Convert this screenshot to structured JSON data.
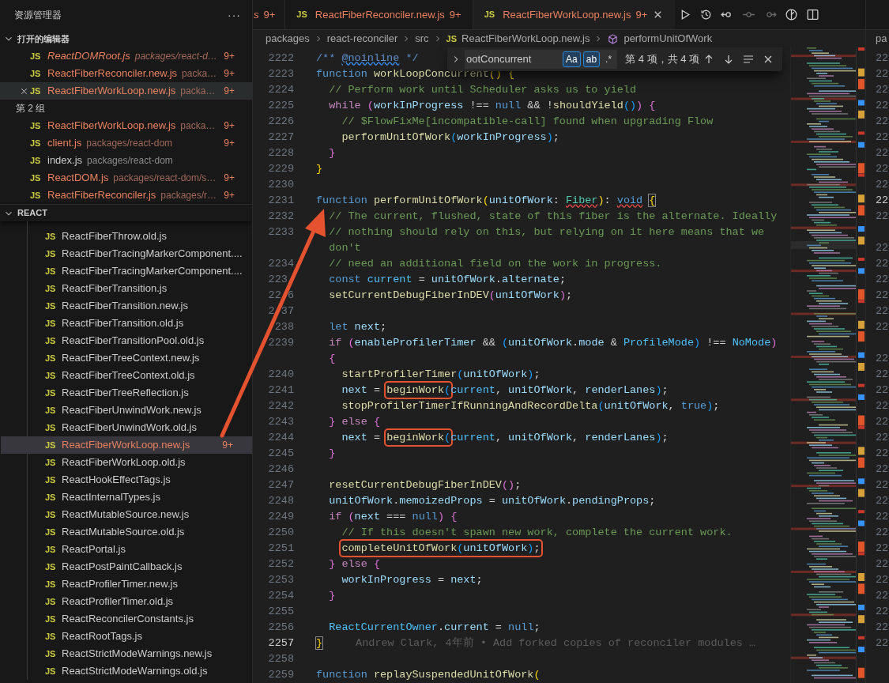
{
  "sidebar": {
    "title": "资源管理器",
    "more": "···",
    "open_editors": {
      "label": "打开的编辑器",
      "expanded": true,
      "groups": [
        {
          "items": [
            {
              "icon": "JS",
              "name": "ReactDOMRoot.js",
              "path": "packages/react-d…",
              "badge": "9+",
              "modified": true,
              "preview": true,
              "selected": false
            },
            {
              "icon": "JS",
              "name": "ReactFiberReconciler.new.js",
              "path": "packa…",
              "badge": "9+",
              "modified": true,
              "preview": false,
              "selected": false
            },
            {
              "icon": "JS",
              "name": "ReactFiberWorkLoop.new.js",
              "path": "packa…",
              "badge": "9+",
              "modified": true,
              "preview": false,
              "selected": true
            }
          ]
        },
        {
          "label": "第 2 组",
          "items": [
            {
              "icon": "JS",
              "name": "ReactFiberWorkLoop.new.js",
              "path": "packa…",
              "badge": "9+",
              "modified": true,
              "preview": false,
              "selected": false
            },
            {
              "icon": "JS",
              "name": "client.js",
              "path": "packages/react-dom",
              "badge": "9+",
              "modified": true,
              "preview": false,
              "selected": false
            },
            {
              "icon": "JS",
              "name": "index.js",
              "path": "packages/react-dom",
              "modified": false,
              "preview": false,
              "selected": false
            },
            {
              "icon": "JS",
              "name": "ReactDOM.js",
              "path": "packages/react-dom/s…",
              "badge": "9+",
              "modified": true,
              "preview": false,
              "selected": false
            },
            {
              "icon": "JS",
              "name": "ReactFiberReconciler.js",
              "path": "packages/r…",
              "badge": "9+",
              "modified": true,
              "preview": false,
              "selected": false
            }
          ]
        }
      ]
    },
    "folder": {
      "label": "REACT",
      "expanded": true,
      "files": [
        {
          "icon": "JS",
          "name": "ReactFiberThrow.old.js",
          "modified": false,
          "selected": false
        },
        {
          "icon": "JS",
          "name": "ReactFiberTracingMarkerComponent....",
          "modified": false,
          "selected": false
        },
        {
          "icon": "JS",
          "name": "ReactFiberTracingMarkerComponent....",
          "modified": false,
          "selected": false
        },
        {
          "icon": "JS",
          "name": "ReactFiberTransition.js",
          "modified": false,
          "selected": false
        },
        {
          "icon": "JS",
          "name": "ReactFiberTransition.new.js",
          "modified": false,
          "selected": false
        },
        {
          "icon": "JS",
          "name": "ReactFiberTransition.old.js",
          "modified": false,
          "selected": false
        },
        {
          "icon": "JS",
          "name": "ReactFiberTransitionPool.old.js",
          "modified": false,
          "selected": false
        },
        {
          "icon": "JS",
          "name": "ReactFiberTreeContext.new.js",
          "modified": false,
          "selected": false
        },
        {
          "icon": "JS",
          "name": "ReactFiberTreeContext.old.js",
          "modified": false,
          "selected": false
        },
        {
          "icon": "JS",
          "name": "ReactFiberTreeReflection.js",
          "modified": false,
          "selected": false
        },
        {
          "icon": "JS",
          "name": "ReactFiberUnwindWork.new.js",
          "modified": false,
          "selected": false
        },
        {
          "icon": "JS",
          "name": "ReactFiberUnwindWork.old.js",
          "modified": false,
          "selected": false
        },
        {
          "icon": "JS",
          "name": "ReactFiberWorkLoop.new.js",
          "badge": "9+",
          "modified": true,
          "selected": true
        },
        {
          "icon": "JS",
          "name": "ReactFiberWorkLoop.old.js",
          "modified": false,
          "selected": false
        },
        {
          "icon": "JS",
          "name": "ReactHookEffectTags.js",
          "modified": false,
          "selected": false
        },
        {
          "icon": "JS",
          "name": "ReactInternalTypes.js",
          "modified": false,
          "selected": false
        },
        {
          "icon": "JS",
          "name": "ReactMutableSource.new.js",
          "modified": false,
          "selected": false
        },
        {
          "icon": "JS",
          "name": "ReactMutableSource.old.js",
          "modified": false,
          "selected": false
        },
        {
          "icon": "JS",
          "name": "ReactPortal.js",
          "modified": false,
          "selected": false
        },
        {
          "icon": "JS",
          "name": "ReactPostPaintCallback.js",
          "modified": false,
          "selected": false
        },
        {
          "icon": "JS",
          "name": "ReactProfilerTimer.new.js",
          "modified": false,
          "selected": false
        },
        {
          "icon": "JS",
          "name": "ReactProfilerTimer.old.js",
          "modified": false,
          "selected": false
        },
        {
          "icon": "JS",
          "name": "ReactReconcilerConstants.js",
          "modified": false,
          "selected": false
        },
        {
          "icon": "JS",
          "name": "ReactRootTags.js",
          "modified": false,
          "selected": false
        },
        {
          "icon": "JS",
          "name": "ReactStrictModeWarnings.new.js",
          "modified": false,
          "selected": false
        },
        {
          "icon": "JS",
          "name": "ReactStrictModeWarnings.old.js",
          "modified": false,
          "selected": false
        }
      ]
    }
  },
  "tabs": [
    {
      "label": "s",
      "badge": "9+",
      "preview": true,
      "selected": false
    },
    {
      "icon": "JS",
      "label": "ReactFiberReconciler.new.js",
      "badge": "9+",
      "preview": false,
      "selected": false
    },
    {
      "icon": "JS",
      "label": "ReactFiberWorkLoop.new.js",
      "badge": "9+",
      "preview": false,
      "selected": true
    }
  ],
  "breadcrumbs": [
    {
      "kind": "folder",
      "label": "packages"
    },
    {
      "kind": "folder",
      "label": "react-reconciler"
    },
    {
      "kind": "folder",
      "label": "src"
    },
    {
      "kind": "file",
      "icon": "JS",
      "label": "ReactFiberWorkLoop.new.js"
    },
    {
      "kind": "symbol",
      "label": "performUnitOfWork"
    }
  ],
  "find": {
    "expanded": false,
    "value": "ootConcurrent",
    "options": [
      {
        "label": "Aa",
        "on": true
      },
      {
        "label": "ab",
        "on": true
      },
      {
        "label": ".*",
        "on": false
      }
    ],
    "result": "第 4 项，共 4 项"
  },
  "code": {
    "lines": [
      {
        "number": "2222",
        "tokens": [
          {
            "text": "/** ",
            "kind": "doc"
          },
          {
            "text": "@noinline",
            "kind": "doc",
            "info_squiggle": true
          },
          {
            "text": " */",
            "kind": "doc"
          }
        ]
      },
      {
        "number": "2223",
        "tokens": [
          {
            "text": "function",
            "kind": "kw"
          },
          {
            "text": " workLoopConcurrent",
            "kind": "fn"
          },
          {
            "text": "()",
            "kind": "b1"
          },
          {
            "text": " {",
            "kind": "b1"
          }
        ]
      },
      {
        "number": "2224",
        "tokens": [
          {
            "text": "  // Perform work until Scheduler asks us to yield",
            "kind": "cmt"
          }
        ]
      },
      {
        "number": "2225",
        "tokens": [
          {
            "text": "  while",
            "kind": "ctrl"
          },
          {
            "text": " (",
            "kind": "b2"
          },
          {
            "text": "workInProgress",
            "kind": "var"
          },
          {
            "text": " !== ",
            "kind": "plain"
          },
          {
            "text": "null",
            "kind": "kw"
          },
          {
            "text": " && !",
            "kind": "plain"
          },
          {
            "text": "shouldYield",
            "kind": "fn"
          },
          {
            "text": "()",
            "kind": "b3"
          },
          {
            "text": ")",
            "kind": "b2"
          },
          {
            "text": " {",
            "kind": "b2"
          }
        ]
      },
      {
        "number": "2226",
        "tokens": [
          {
            "text": "    // $FlowFixMe[incompatible-call] found when upgrading Flow",
            "kind": "cmt"
          }
        ]
      },
      {
        "number": "2227",
        "tokens": [
          {
            "text": "    performUnitOfWork",
            "kind": "fn"
          },
          {
            "text": "(",
            "kind": "b3"
          },
          {
            "text": "workInProgress",
            "kind": "var"
          },
          {
            "text": ")",
            "kind": "b3"
          },
          {
            "text": ";",
            "kind": "plain"
          }
        ]
      },
      {
        "number": "2228",
        "tokens": [
          {
            "text": "  }",
            "kind": "b2"
          }
        ]
      },
      {
        "number": "2229",
        "tokens": [
          {
            "text": "}",
            "kind": "b1"
          }
        ]
      },
      {
        "number": "2230"
      },
      {
        "number": "2231",
        "tokens": [
          {
            "text": "function",
            "kind": "kw"
          },
          {
            "text": " performUnitOfWork",
            "kind": "fn"
          },
          {
            "text": "(",
            "kind": "b1"
          },
          {
            "text": "unitOfWork",
            "kind": "var"
          },
          {
            "text": ": ",
            "kind": "plain"
          },
          {
            "text": "Fiber",
            "kind": "type",
            "error_squiggle": true
          },
          {
            "text": ")",
            "kind": "b1"
          },
          {
            "text": ": ",
            "kind": "plain"
          },
          {
            "text": "void",
            "kind": "kw",
            "error_squiggle": true
          },
          {
            "text": "{",
            "kind": "b1",
            "matched": true
          }
        ]
      },
      {
        "number": "2232",
        "tokens": [
          {
            "text": "  // The current, flushed, state of this fiber is the alternate. Ideally",
            "kind": "cmt"
          }
        ]
      },
      {
        "number": "2233",
        "tokens": [
          {
            "text": "  // nothing should rely on this, but relying on it here means that we",
            "kind": "cmt"
          }
        ]
      },
      {
        "tokens": [
          {
            "text": "  don't",
            "kind": "cmt"
          }
        ]
      },
      {
        "number": "2234",
        "tokens": [
          {
            "text": "  // need an additional field on the work in progress.",
            "kind": "cmt"
          }
        ]
      },
      {
        "number": "223 ",
        "tokens": [
          {
            "text": "  const",
            "kind": "kw"
          },
          {
            "text": " current",
            "kind": "const"
          },
          {
            "text": " = ",
            "kind": "plain"
          },
          {
            "text": "unitOfWork",
            "kind": "var"
          },
          {
            "text": ".",
            "kind": "plain"
          },
          {
            "text": "alternate",
            "kind": "var"
          },
          {
            "text": ";",
            "kind": "plain"
          }
        ]
      },
      {
        "number": "22 6",
        "tokens": [
          {
            "text": "  setCurrentDebugFiberInDEV",
            "kind": "fn"
          },
          {
            "text": "(",
            "kind": "b2"
          },
          {
            "text": "unitOfWork",
            "kind": "var"
          },
          {
            "text": ")",
            "kind": "b2"
          },
          {
            "text": ";",
            "kind": "plain"
          }
        ]
      },
      {
        "number": "2 37"
      },
      {
        "number": " 238",
        "tokens": [
          {
            "text": "  let",
            "kind": "kw"
          },
          {
            "text": " next",
            "kind": "var"
          },
          {
            "text": ";",
            "kind": "plain"
          }
        ]
      },
      {
        "number": "2239",
        "tokens": [
          {
            "text": "  if",
            "kind": "ctrl"
          },
          {
            "text": " (",
            "kind": "b2"
          },
          {
            "text": "enableProfilerTimer",
            "kind": "var"
          },
          {
            "text": " && ",
            "kind": "plain"
          },
          {
            "text": "(",
            "kind": "b3"
          },
          {
            "text": "unitOfWork",
            "kind": "var"
          },
          {
            "text": ".",
            "kind": "plain"
          },
          {
            "text": "mode",
            "kind": "var"
          },
          {
            "text": " & ",
            "kind": "plain"
          },
          {
            "text": "ProfileMode",
            "kind": "const"
          },
          {
            "text": ")",
            "kind": "b3"
          },
          {
            "text": " !== ",
            "kind": "plain"
          },
          {
            "text": "NoMode",
            "kind": "const"
          },
          {
            "text": ")",
            "kind": "b2"
          }
        ]
      },
      {
        "tokens": [
          {
            "text": "  {",
            "kind": "b2"
          }
        ]
      },
      {
        "number": "2240",
        "tokens": [
          {
            "text": "    startProfilerTimer",
            "kind": "fn"
          },
          {
            "text": "(",
            "kind": "b3"
          },
          {
            "text": "unitOfWork",
            "kind": "var"
          },
          {
            "text": ")",
            "kind": "b3"
          },
          {
            "text": ";",
            "kind": "plain"
          }
        ]
      },
      {
        "number": "2241",
        "tokens": [
          {
            "text": "    next",
            "kind": "var"
          },
          {
            "text": " = ",
            "kind": "plain"
          },
          {
            "boxed": true,
            "parts": [
              {
                "text": "beginWork",
                "kind": "fn"
              },
              {
                "text": "(",
                "kind": "b3"
              }
            ]
          },
          {
            "text": "current",
            "kind": "const"
          },
          {
            "text": ", ",
            "kind": "plain"
          },
          {
            "text": "unitOfWork",
            "kind": "var"
          },
          {
            "text": ", ",
            "kind": "plain"
          },
          {
            "text": "renderLanes",
            "kind": "var"
          },
          {
            "text": ")",
            "kind": "b3"
          },
          {
            "text": ";",
            "kind": "plain"
          }
        ]
      },
      {
        "number": "2242",
        "tokens": [
          {
            "text": "    stopProfilerTimerIfRunningAndRecordDelta",
            "kind": "fn"
          },
          {
            "text": "(",
            "kind": "b3"
          },
          {
            "text": "unitOfWork",
            "kind": "var"
          },
          {
            "text": ", ",
            "kind": "plain"
          },
          {
            "text": "true",
            "kind": "kw"
          },
          {
            "text": ")",
            "kind": "b3"
          },
          {
            "text": ";",
            "kind": "plain"
          }
        ]
      },
      {
        "number": "2243",
        "tokens": [
          {
            "text": "  }",
            "kind": "b2"
          },
          {
            "text": " else",
            "kind": "ctrl"
          },
          {
            "text": " {",
            "kind": "b2"
          }
        ]
      },
      {
        "number": "2244",
        "tokens": [
          {
            "text": "    next",
            "kind": "var"
          },
          {
            "text": " = ",
            "kind": "plain"
          },
          {
            "boxed": true,
            "parts": [
              {
                "text": "beginWork",
                "kind": "fn"
              },
              {
                "text": "(",
                "kind": "b3"
              }
            ]
          },
          {
            "text": "current",
            "kind": "const"
          },
          {
            "text": ", ",
            "kind": "plain"
          },
          {
            "text": "unitOfWork",
            "kind": "var"
          },
          {
            "text": ", ",
            "kind": "plain"
          },
          {
            "text": "renderLanes",
            "kind": "var"
          },
          {
            "text": ")",
            "kind": "b3"
          },
          {
            "text": ";",
            "kind": "plain"
          }
        ]
      },
      {
        "number": "2245",
        "tokens": [
          {
            "text": "  }",
            "kind": "b2"
          }
        ]
      },
      {
        "number": "2246"
      },
      {
        "number": "2247",
        "tokens": [
          {
            "text": "  resetCurrentDebugFiberInDEV",
            "kind": "fn"
          },
          {
            "text": "()",
            "kind": "b2"
          },
          {
            "text": ";",
            "kind": "plain"
          }
        ]
      },
      {
        "number": "2248",
        "tokens": [
          {
            "text": "  unitOfWork",
            "kind": "var"
          },
          {
            "text": ".",
            "kind": "plain"
          },
          {
            "text": "memoizedProps",
            "kind": "var"
          },
          {
            "text": " = ",
            "kind": "plain"
          },
          {
            "text": "unitOfWork",
            "kind": "var"
          },
          {
            "text": ".",
            "kind": "plain"
          },
          {
            "text": "pendingProps",
            "kind": "var"
          },
          {
            "text": ";",
            "kind": "plain"
          }
        ]
      },
      {
        "number": "2249",
        "tokens": [
          {
            "text": "  if",
            "kind": "ctrl"
          },
          {
            "text": " (",
            "kind": "b2"
          },
          {
            "text": "next",
            "kind": "var"
          },
          {
            "text": " === ",
            "kind": "plain"
          },
          {
            "text": "null",
            "kind": "kw"
          },
          {
            "text": ")",
            "kind": "b2"
          },
          {
            "text": " {",
            "kind": "b2"
          }
        ]
      },
      {
        "number": "2250",
        "tokens": [
          {
            "text": "    // If this doesn't spawn new work, complete the current work.",
            "kind": "cmt"
          }
        ]
      },
      {
        "number": "2251",
        "tokens": [
          {
            "boxed": true,
            "parts": [
              {
                "text": "    completeUnitOfWork",
                "kind": "fn"
              },
              {
                "text": "(",
                "kind": "b3"
              },
              {
                "text": "unitOfWork",
                "kind": "var"
              },
              {
                "text": ")",
                "kind": "b3"
              },
              {
                "text": ";",
                "kind": "plain"
              }
            ]
          }
        ]
      },
      {
        "number": "2252",
        "tokens": [
          {
            "text": "  }",
            "kind": "b2"
          },
          {
            "text": " else",
            "kind": "ctrl"
          },
          {
            "text": " {",
            "kind": "b2"
          }
        ]
      },
      {
        "number": "2253",
        "tokens": [
          {
            "text": "    workInProgress",
            "kind": "var"
          },
          {
            "text": " = ",
            "kind": "plain"
          },
          {
            "text": "next",
            "kind": "var"
          },
          {
            "text": ";",
            "kind": "plain"
          }
        ]
      },
      {
        "number": "2254",
        "tokens": [
          {
            "text": "  }",
            "kind": "b2"
          }
        ]
      },
      {
        "number": "2255"
      },
      {
        "number": "2256",
        "tokens": [
          {
            "text": "  ReactCurrentOwner",
            "kind": "const"
          },
          {
            "text": ".",
            "kind": "plain"
          },
          {
            "text": "current",
            "kind": "var"
          },
          {
            "text": " = ",
            "kind": "plain"
          },
          {
            "text": "null",
            "kind": "kw"
          },
          {
            "text": ";",
            "kind": "plain"
          }
        ]
      },
      {
        "number": "2257",
        "current": true,
        "tokens": [
          {
            "text": "}",
            "kind": "b1",
            "matched": true
          }
        ],
        "blame": "Andrew Clark, 4年前 • Add forked copies of reconciler modules …"
      },
      {
        "number": "2258"
      },
      {
        "number": "2259",
        "tokens": [
          {
            "text": "function",
            "kind": "kw"
          },
          {
            "text": " replaySuspendedUnitOfWork",
            "kind": "fn"
          },
          {
            "text": "(",
            "kind": "b1"
          }
        ]
      }
    ]
  },
  "right_group": {
    "breadcrumb": "pa",
    "line_numbers": [
      {
        "text": "22",
        "current": false,
        "wrapped": false
      },
      {
        "text": "22",
        "current": false,
        "wrapped": false
      },
      {
        "text": "22",
        "current": false,
        "wrapped": false
      },
      {
        "text": "22",
        "current": false,
        "wrapped": false
      },
      {
        "text": "22",
        "current": false,
        "wrapped": false
      },
      {
        "text": "22",
        "current": false,
        "wrapped": false
      },
      {
        "text": "22",
        "current": false,
        "wrapped": false
      },
      {
        "text": "22",
        "current": false,
        "wrapped": false
      },
      {
        "text": "22",
        "current": false,
        "wrapped": false
      },
      {
        "text": "22",
        "current": true,
        "wrapped": false
      },
      {
        "text": "22",
        "current": false,
        "wrapped": true
      },
      {
        "text": "22",
        "current": false,
        "wrapped": false
      },
      {
        "text": "22",
        "current": false,
        "wrapped": false
      },
      {
        "text": "22",
        "current": false,
        "wrapped": false
      },
      {
        "text": "22",
        "current": false,
        "wrapped": false
      },
      {
        "text": "22",
        "current": false,
        "wrapped": false
      },
      {
        "text": "22",
        "current": false,
        "wrapped": true
      },
      {
        "text": "22",
        "current": false,
        "wrapped": false
      },
      {
        "text": "22",
        "current": false,
        "wrapped": false
      },
      {
        "text": "22",
        "current": false,
        "wrapped": false
      },
      {
        "text": "22",
        "current": false,
        "wrapped": false
      },
      {
        "text": "22",
        "current": false,
        "wrapped": false
      },
      {
        "text": "22",
        "current": false,
        "wrapped": false
      },
      {
        "text": "22",
        "current": false,
        "wrapped": false
      },
      {
        "text": "22",
        "current": false,
        "wrapped": false
      },
      {
        "text": "22",
        "current": false,
        "wrapped": false
      },
      {
        "text": "22",
        "current": false,
        "wrapped": false
      },
      {
        "text": "22",
        "current": false,
        "wrapped": false
      },
      {
        "text": "22",
        "current": false,
        "wrapped": false
      },
      {
        "text": "22",
        "current": false,
        "wrapped": false
      },
      {
        "text": "22",
        "current": false,
        "wrapped": false
      },
      {
        "text": "22",
        "current": false,
        "wrapped": false
      },
      {
        "text": "22",
        "current": false,
        "wrapped": false
      },
      {
        "text": "22",
        "current": false,
        "wrapped": false
      },
      {
        "text": "22",
        "current": false,
        "wrapped": false
      },
      {
        "text": "22",
        "current": false,
        "wrapped": false
      }
    ]
  }
}
